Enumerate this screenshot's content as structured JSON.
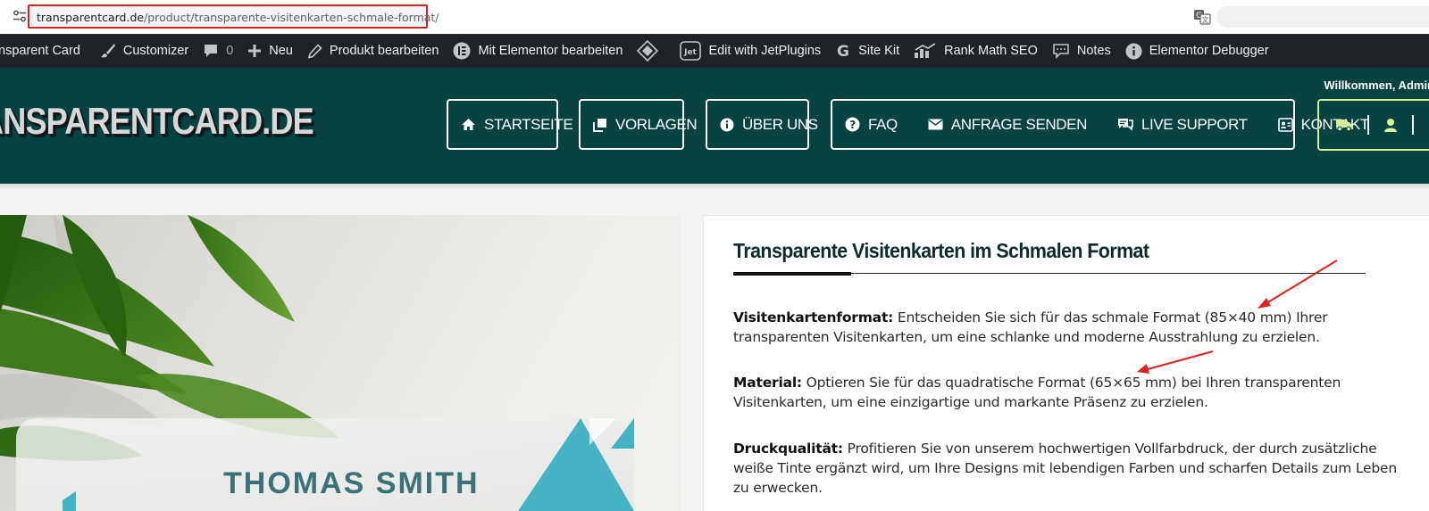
{
  "browser": {
    "url_host": "transparentcard.de",
    "url_path": "/product/transparente-visitenkarten-schmale-format/"
  },
  "admin_bar": {
    "site_name": "nsparent Card",
    "customizer": "Customizer",
    "comments_count": "0",
    "new": "Neu",
    "edit_product": "Produkt bearbeiten",
    "elementor_edit": "Mit Elementor bearbeiten",
    "jetplugins": "Edit with JetPlugins",
    "site_kit": "Site Kit",
    "rank_math": "Rank Math SEO",
    "notes": "Notes",
    "elementor_debugger": "Elementor Debugger"
  },
  "header": {
    "welcome": "Willkommen, Admin",
    "logo": "ANSPARENTCARD.DE",
    "nav": {
      "start": "STARTSEITE",
      "templates": "VORLAGEN",
      "about": "ÜBER UNS",
      "faq": "FAQ",
      "request": "ANFRAGE SENDEN",
      "support": "LIVE SUPPORT",
      "contact": "KONTAKT"
    }
  },
  "product_image": {
    "card_name": "THOMAS SMITH"
  },
  "description": {
    "title": "Transparente Visitenkarten im Schmalen Format",
    "p1_label": "Visitenkartenformat:",
    "p1_text": " Entscheiden Sie sich für das schmale Format (85×40 mm) Ihrer transparenten Visitenkarten, um eine schlanke und moderne Ausstrahlung zu erzielen.",
    "p2_label": "Material:",
    "p2_text": " Optieren Sie für das quadratische Format (65×65 mm) bei Ihren transparenten Visitenkarten, um eine einzigartige und markante Präsenz zu erzielen.",
    "p3_label": "Druckqualität:",
    "p3_text": " Profitieren Sie von unserem hochwertigen Vollfarbdruck, der durch zusätzliche weiße Tinte ergänzt wird, um Ihre Designs mit lebendigen Farben und scharfen Details zum Leben zu erwecken."
  },
  "colors": {
    "header_bg": "#064240",
    "admin_bar_bg": "#1d2327",
    "url_highlight": "#e0201f",
    "annotation_arrow": "#e0201f",
    "card_accent": "#46b3c4"
  }
}
